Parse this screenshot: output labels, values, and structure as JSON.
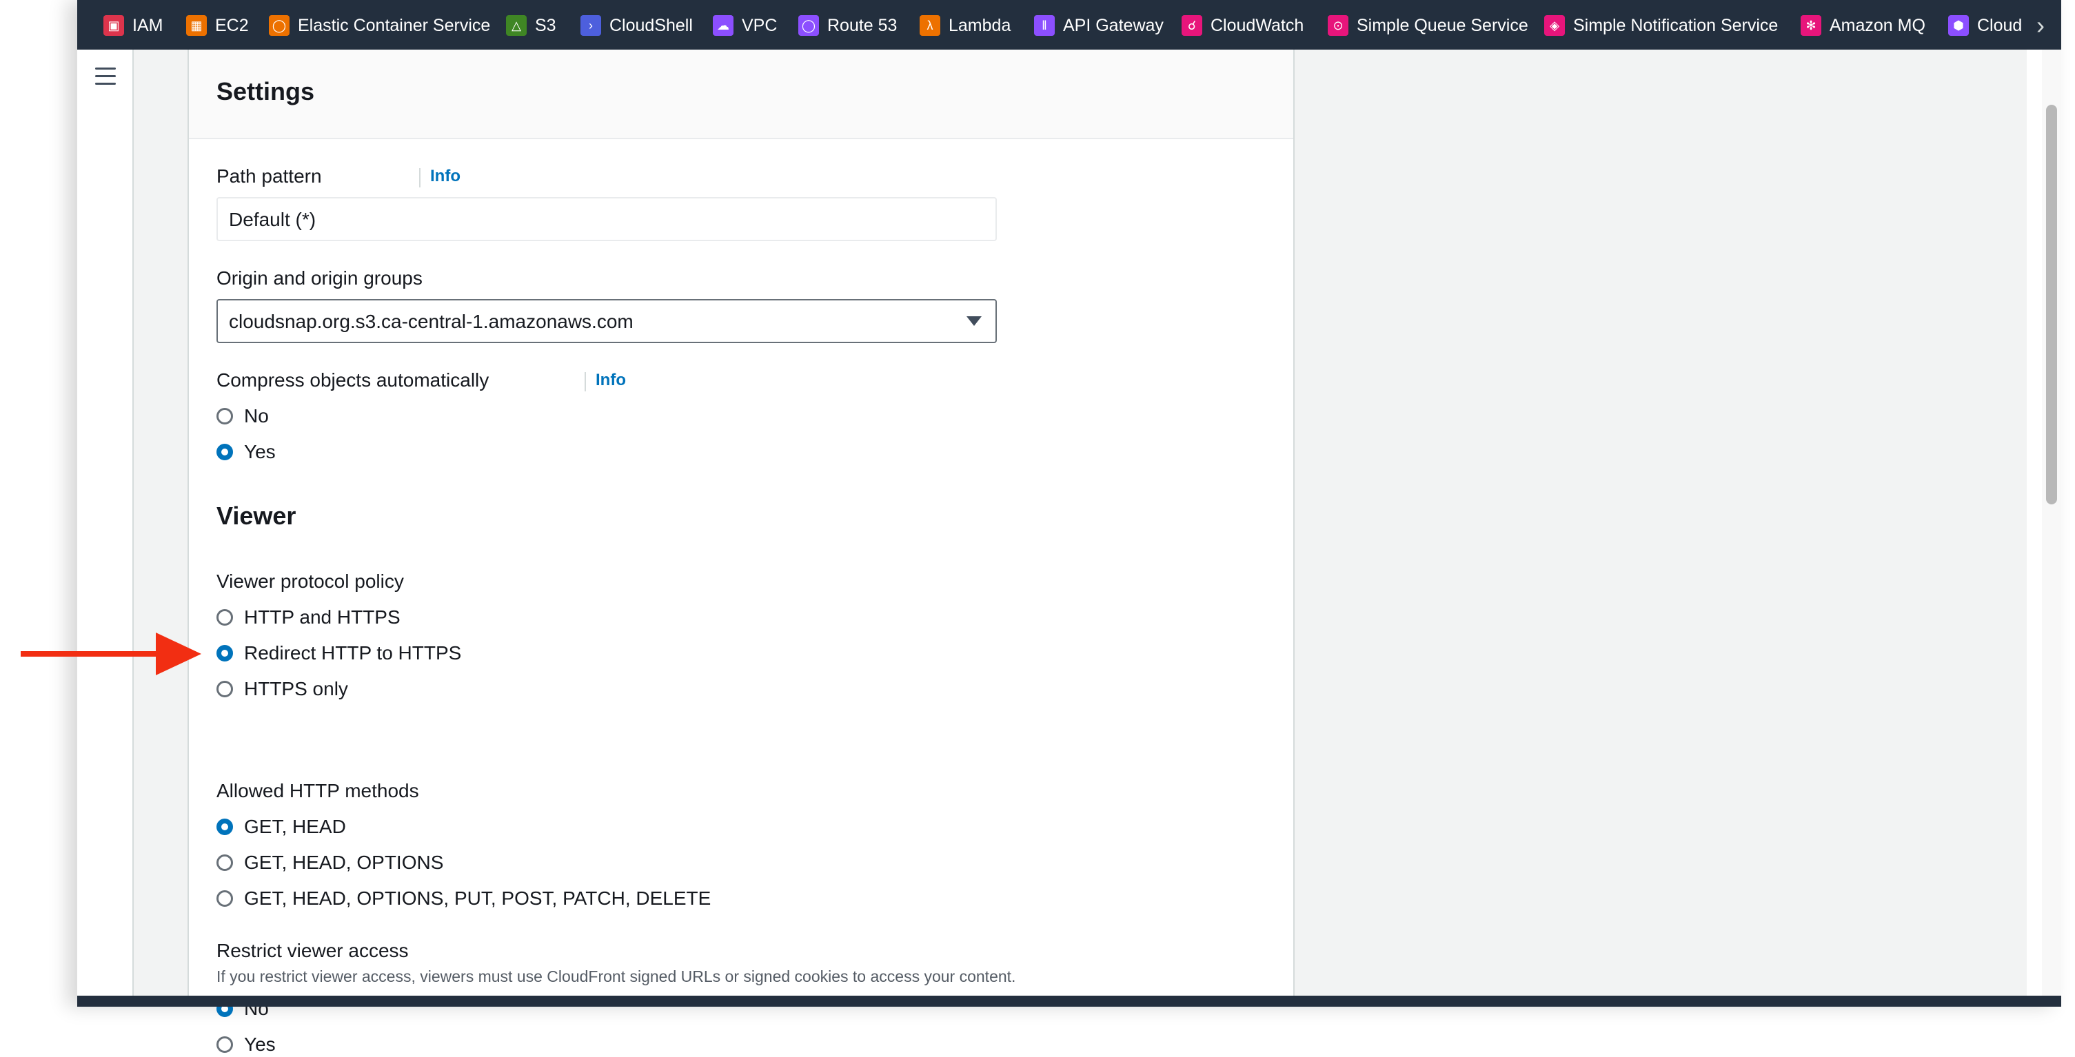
{
  "favorites": [
    {
      "label": "IAM",
      "icon": "iam-icon",
      "color": "#dd344c"
    },
    {
      "label": "EC2",
      "icon": "ec2-icon",
      "color": "#ed7100"
    },
    {
      "label": "Elastic Container Service",
      "icon": "ecs-icon",
      "color": "#ed7100"
    },
    {
      "label": "S3",
      "icon": "s3-icon",
      "color": "#3f8624"
    },
    {
      "label": "CloudShell",
      "icon": "cloudshell-icon",
      "color": "#4d5fdd"
    },
    {
      "label": "VPC",
      "icon": "vpc-icon",
      "color": "#8c4fff"
    },
    {
      "label": "Route 53",
      "icon": "route53-icon",
      "color": "#8c4fff"
    },
    {
      "label": "Lambda",
      "icon": "lambda-icon",
      "color": "#ed7100"
    },
    {
      "label": "API Gateway",
      "icon": "api-gateway-icon",
      "color": "#8c4fff"
    },
    {
      "label": "CloudWatch",
      "icon": "cloudwatch-icon",
      "color": "#e7157b"
    },
    {
      "label": "Simple Queue Service",
      "icon": "sqs-icon",
      "color": "#e7157b"
    },
    {
      "label": "Simple Notification Service",
      "icon": "sns-icon",
      "color": "#e7157b"
    },
    {
      "label": "Amazon MQ",
      "icon": "amazon-mq-icon",
      "color": "#e7157b"
    },
    {
      "label": "Cloud",
      "icon": "cloud-service-icon",
      "color": "#8c4fff"
    }
  ],
  "settings": {
    "title": "Settings",
    "path_pattern": {
      "label": "Path pattern",
      "info": "Info",
      "value": "Default (*)"
    },
    "origin": {
      "label": "Origin and origin groups",
      "value": "cloudsnap.org.s3.ca-central-1.amazonaws.com"
    },
    "compress": {
      "label": "Compress objects automatically",
      "info": "Info",
      "options": [
        "No",
        "Yes"
      ],
      "selected": "Yes"
    }
  },
  "viewer": {
    "title": "Viewer",
    "protocol_policy": {
      "label": "Viewer protocol policy",
      "options": [
        "HTTP and HTTPS",
        "Redirect HTTP to HTTPS",
        "HTTPS only"
      ],
      "selected": "Redirect HTTP to HTTPS"
    },
    "allowed_methods": {
      "label": "Allowed HTTP methods",
      "options": [
        "GET, HEAD",
        "GET, HEAD, OPTIONS",
        "GET, HEAD, OPTIONS, PUT, POST, PATCH, DELETE"
      ],
      "selected": "GET, HEAD"
    },
    "restrict_access": {
      "label": "Restrict viewer access",
      "description": "If you restrict viewer access, viewers must use CloudFront signed URLs or signed cookies to access your content.",
      "options": [
        "No",
        "Yes"
      ],
      "selected": "No"
    }
  },
  "colors": {
    "accent": "#0073bb",
    "annotation_arrow": "#f22e12",
    "topbar": "#232f3e"
  }
}
